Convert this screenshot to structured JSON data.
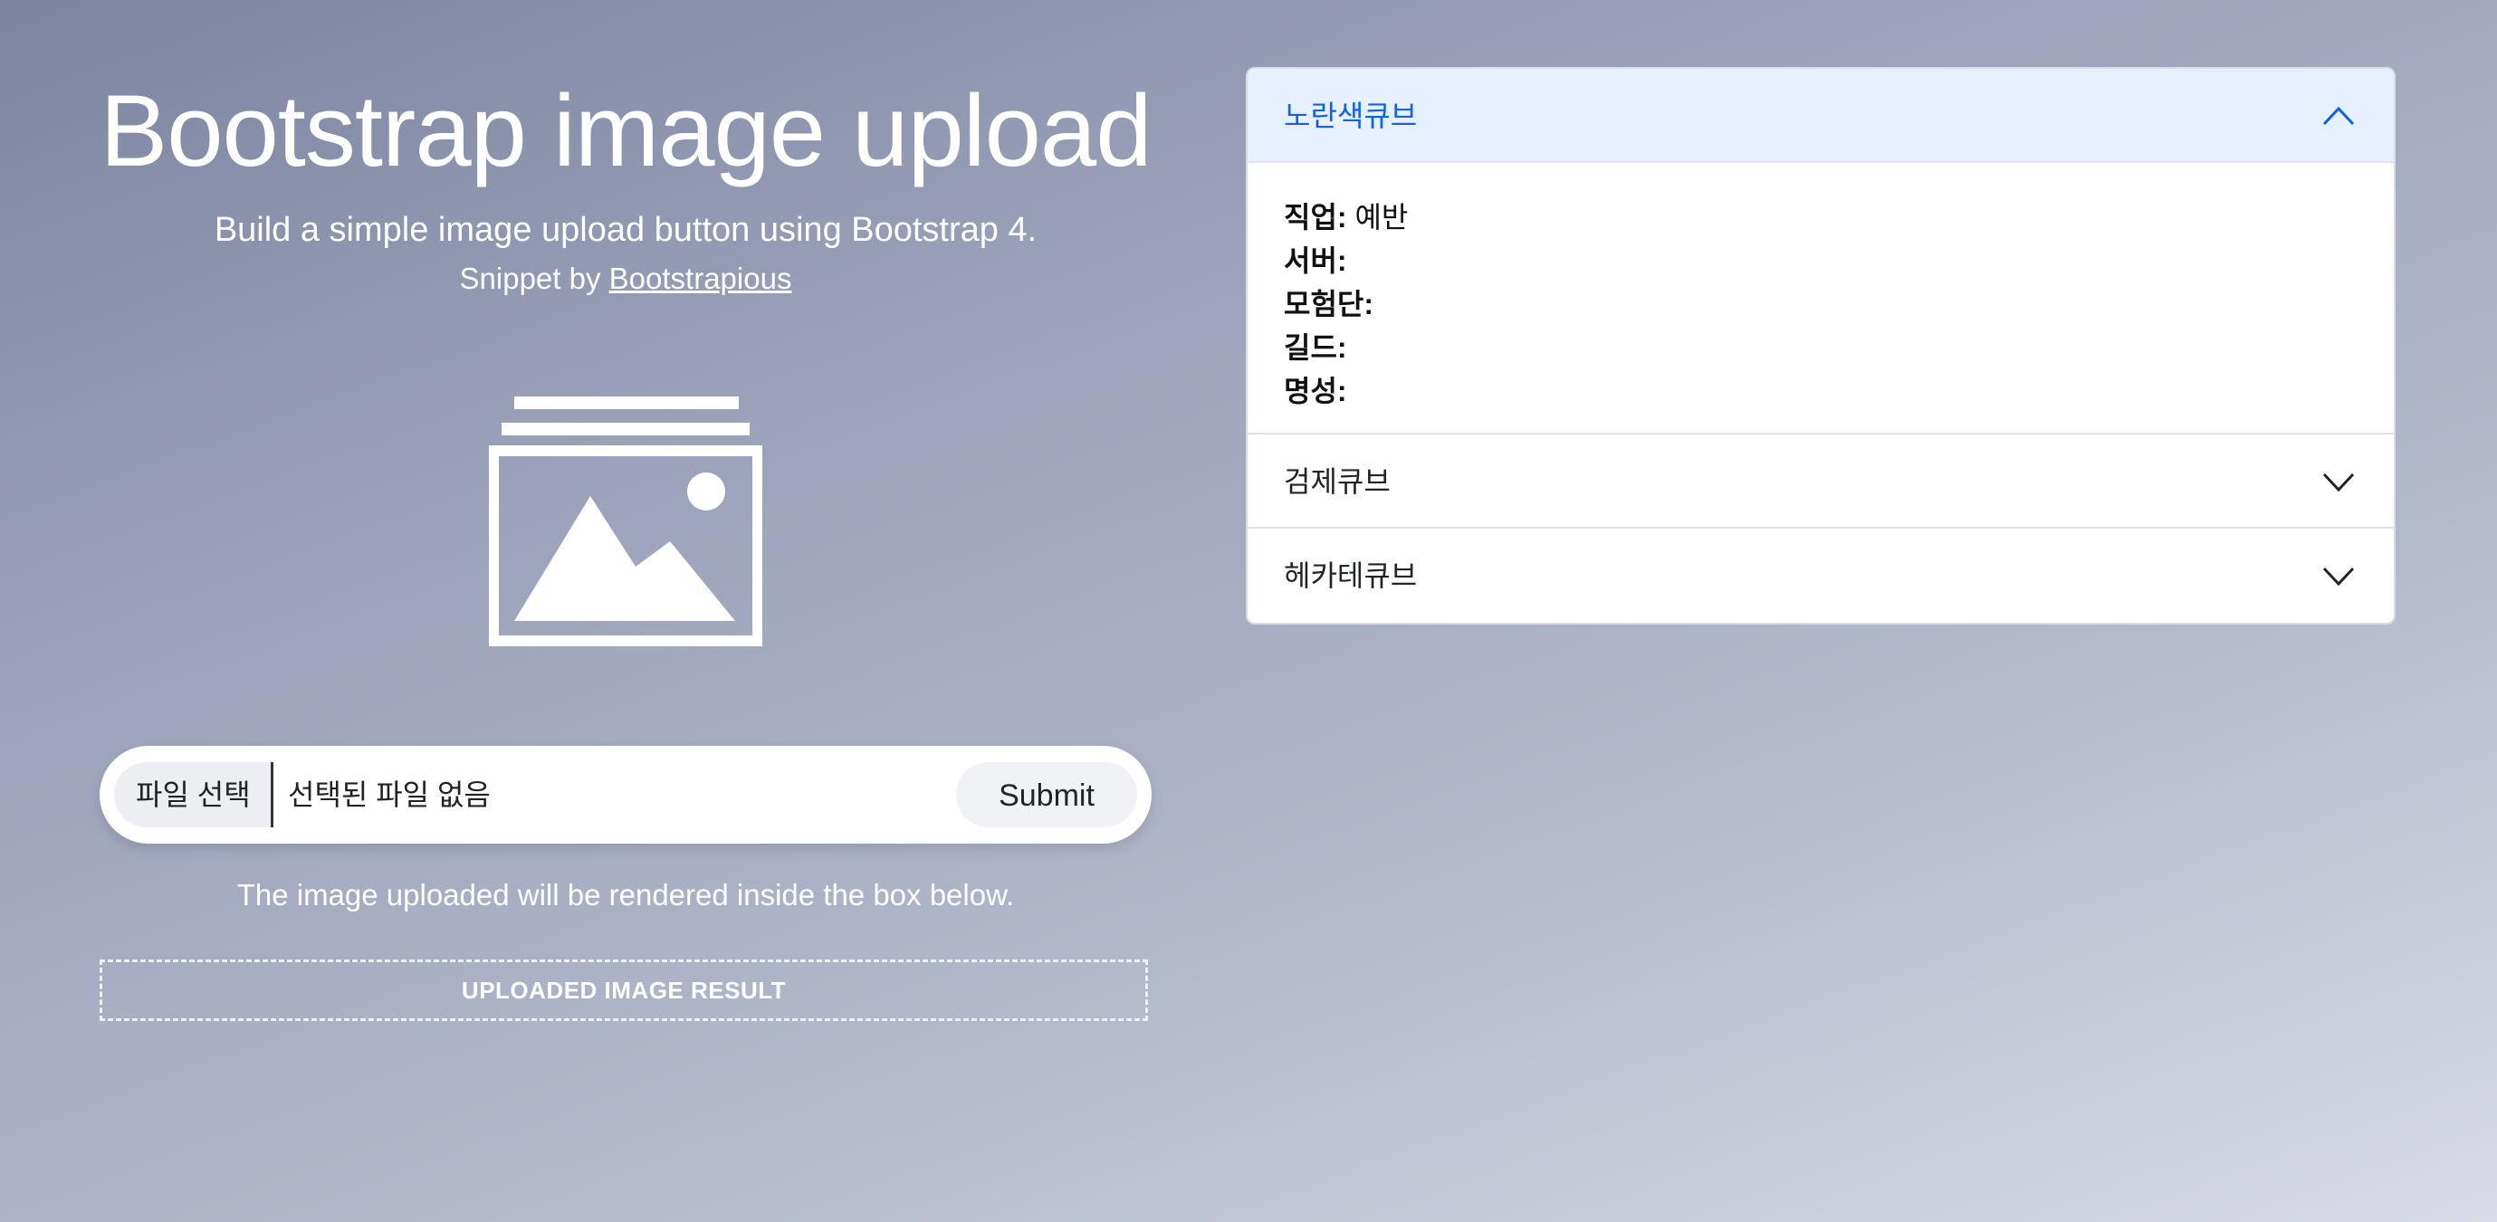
{
  "hero": {
    "title": "Bootstrap image upload",
    "subtitle": "Build a simple image upload button using Bootstrap 4.",
    "credit_prefix": "Snippet by ",
    "credit_link": "Bootstrapious",
    "icon": "image-icon"
  },
  "upload": {
    "choose_label": "파일 선택",
    "status": "선택된 파일 없음",
    "submit_label": "Submit",
    "note": "The image uploaded will be rendered inside the box below.",
    "result_label": "UPLOADED IMAGE RESULT"
  },
  "accordion": {
    "items": [
      {
        "title": "노란색큐브",
        "expanded": true,
        "fields": [
          {
            "key": "직업:",
            "value": "예반"
          },
          {
            "key": "서버:",
            "value": ""
          },
          {
            "key": "모험단:",
            "value": ""
          },
          {
            "key": "길드:",
            "value": ""
          },
          {
            "key": "명성:",
            "value": ""
          }
        ]
      },
      {
        "title": "검제큐브",
        "expanded": false
      },
      {
        "title": "헤카테큐브",
        "expanded": false
      }
    ]
  },
  "colors": {
    "accent": "#0c63e4",
    "active_header_bg": "#e7f0fe",
    "text": "#212529"
  }
}
